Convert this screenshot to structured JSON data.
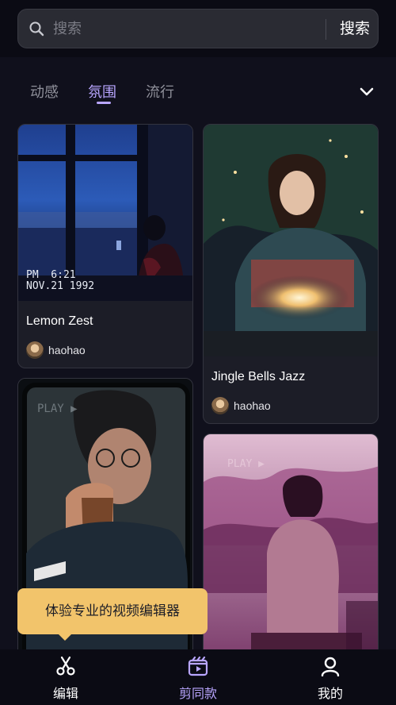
{
  "search": {
    "placeholder": "搜索",
    "button_label": "搜索"
  },
  "tabs": [
    {
      "label": "动感",
      "active": false
    },
    {
      "label": "氛围",
      "active": true
    },
    {
      "label": "流行",
      "active": false
    }
  ],
  "cards": [
    {
      "title": "Lemon Zest",
      "author": "haohao",
      "thumb_overlay": "PM  6:21\nNOV.21 1992"
    },
    {
      "title": "Jingle Bells Jazz",
      "author": "haohao"
    },
    {
      "title": "",
      "author": "",
      "thumb_overlay": "PLAY ▶"
    },
    {
      "title": "",
      "author": "",
      "thumb_overlay": "PLAY ▶"
    }
  ],
  "tooltip": {
    "text": "体验专业的视频编辑器"
  },
  "bottom_nav": [
    {
      "label": "编辑",
      "icon": "scissors-icon",
      "active": false
    },
    {
      "label": "剪同款",
      "icon": "template-video-icon",
      "active": true
    },
    {
      "label": "我的",
      "icon": "profile-icon",
      "active": false
    }
  ],
  "colors": {
    "accent": "#b9a6ff",
    "tooltip": "#f2c46b",
    "background": "#10101c"
  }
}
